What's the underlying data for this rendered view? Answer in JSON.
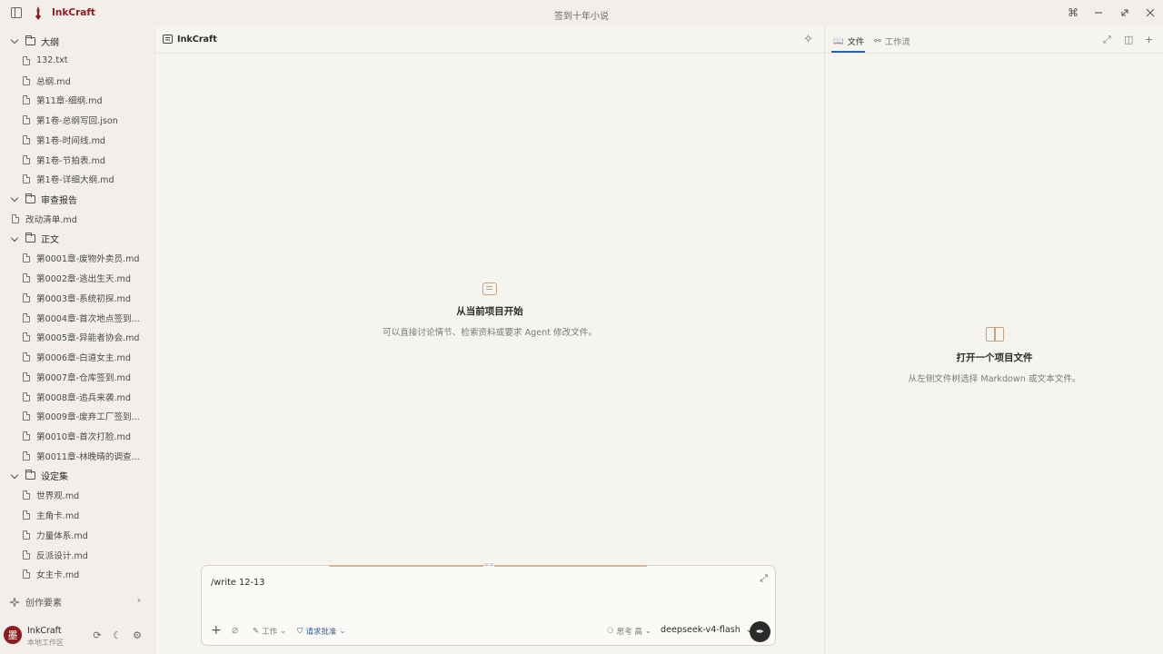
{
  "titlebar": {
    "app_name": "InkCraft",
    "window_title": "签到十年小说",
    "icons": [
      "sidebar-toggle-icon",
      "command-icon",
      "minimize-icon",
      "maximize-icon",
      "close-icon"
    ]
  },
  "file_tree": [
    {
      "type": "folder",
      "label": "大纲",
      "depth": 0
    },
    {
      "type": "file",
      "label": "132.txt",
      "depth": 1
    },
    {
      "type": "file",
      "label": "总纲.md",
      "depth": 1
    },
    {
      "type": "file",
      "label": "第11章-细纲.md",
      "depth": 1
    },
    {
      "type": "file",
      "label": "第1卷-总纲写回.json",
      "depth": 1
    },
    {
      "type": "file",
      "label": "第1卷-时间线.md",
      "depth": 1
    },
    {
      "type": "file",
      "label": "第1卷-节拍表.md",
      "depth": 1
    },
    {
      "type": "file",
      "label": "第1卷-详细大纲.md",
      "depth": 1
    },
    {
      "type": "folder",
      "label": "审查报告",
      "depth": 0
    },
    {
      "type": "file",
      "label": "改动清单.md",
      "depth": 0
    },
    {
      "type": "folder",
      "label": "正文",
      "depth": 0
    },
    {
      "type": "file",
      "label": "第0001章-废物外卖员.md",
      "depth": 1
    },
    {
      "type": "file",
      "label": "第0002章-逃出生天.md",
      "depth": 1
    },
    {
      "type": "file",
      "label": "第0003章-系统初探.md",
      "depth": 1
    },
    {
      "type": "file",
      "label": "第0004章-首次地点签到...",
      "depth": 1
    },
    {
      "type": "file",
      "label": "第0005章-异能者协会.md",
      "depth": 1
    },
    {
      "type": "file",
      "label": "第0006章-白道女主.md",
      "depth": 1
    },
    {
      "type": "file",
      "label": "第0007章-仓库签到.md",
      "depth": 1
    },
    {
      "type": "file",
      "label": "第0008章-追兵来袭.md",
      "depth": 1
    },
    {
      "type": "file",
      "label": "第0009章-废弃工厂签到...",
      "depth": 1
    },
    {
      "type": "file",
      "label": "第0010章-首次打脸.md",
      "depth": 1
    },
    {
      "type": "file",
      "label": "第0011章-林晚晴的调查...",
      "depth": 1
    },
    {
      "type": "folder",
      "label": "设定集",
      "depth": 0
    },
    {
      "type": "file",
      "label": "世界观.md",
      "depth": 1
    },
    {
      "type": "file",
      "label": "主角卡.md",
      "depth": 1
    },
    {
      "type": "file",
      "label": "力量体系.md",
      "depth": 1
    },
    {
      "type": "file",
      "label": "反派设计.md",
      "depth": 1
    },
    {
      "type": "file",
      "label": "女主卡.md",
      "depth": 1
    }
  ],
  "sidebar_footer": {
    "creative_elements": "创作要素"
  },
  "user": {
    "avatar_char": "墨",
    "name": "InkCraft",
    "workspace": "本地工作区"
  },
  "chat": {
    "header_title": "InkCraft",
    "empty_title": "从当前项目开始",
    "empty_subtitle": "可以直接讨论情节、检索资料或要求 Agent 修改文件。",
    "input_value": "/write 12-13",
    "mode_label": "工作",
    "approval_label": "请求批准",
    "thinking_label": "思考 高",
    "model_label": "deepseek-v4-flash"
  },
  "right_panel": {
    "tabs": [
      {
        "label": "文件",
        "active": true
      },
      {
        "label": "工作流",
        "active": false
      }
    ],
    "empty_title": "打开一个项目文件",
    "empty_subtitle": "从左侧文件树选择 Markdown 或文本文件。"
  },
  "colors": {
    "brand": "#8a1e1e",
    "accent_blue": "#2b5fa8",
    "accent_tan": "#c4a27a",
    "background": "#f5f3ef"
  }
}
